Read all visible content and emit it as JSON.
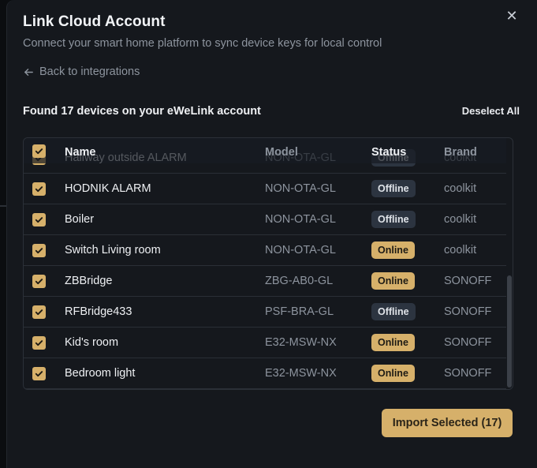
{
  "dialog": {
    "title": "Link Cloud Account",
    "subtitle": "Connect your smart home platform to sync device keys for local control",
    "close_icon": "close-icon",
    "back_label": "Back to integrations",
    "found_text": "Found 17 devices on your eWeLink account",
    "deselect_label": "Deselect All",
    "import_label": "Import Selected (17)"
  },
  "table": {
    "columns": {
      "name": "Name",
      "model": "Model",
      "status": "Status",
      "brand": "Brand"
    },
    "rows": [
      {
        "name": "Hallway outside ALARM",
        "model": "NON-OTA-GL",
        "status": "Offline",
        "brand": "coolkit",
        "checked": true
      },
      {
        "name": "HODNIK ALARM",
        "model": "NON-OTA-GL",
        "status": "Offline",
        "brand": "coolkit",
        "checked": true
      },
      {
        "name": "Boiler",
        "model": "NON-OTA-GL",
        "status": "Offline",
        "brand": "coolkit",
        "checked": true
      },
      {
        "name": "Switch Living room",
        "model": "NON-OTA-GL",
        "status": "Online",
        "brand": "coolkit",
        "checked": true
      },
      {
        "name": "ZBBridge",
        "model": "ZBG-AB0-GL",
        "status": "Online",
        "brand": "SONOFF",
        "checked": true
      },
      {
        "name": "RFBridge433",
        "model": "PSF-BRA-GL",
        "status": "Offline",
        "brand": "SONOFF",
        "checked": true
      },
      {
        "name": "Kid's room",
        "model": "E32-MSW-NX",
        "status": "Online",
        "brand": "SONOFF",
        "checked": true
      },
      {
        "name": "Bedroom light",
        "model": "E32-MSW-NX",
        "status": "Online",
        "brand": "SONOFF",
        "checked": true
      }
    ]
  },
  "colors": {
    "accent": "#d6b06a",
    "background": "#15181d",
    "offline_badge": "#2c3440"
  }
}
